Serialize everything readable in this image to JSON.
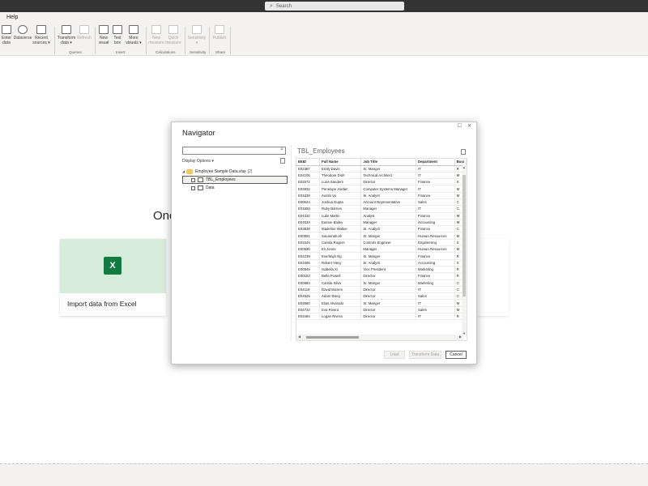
{
  "titlebar": {
    "search_placeholder": "Search"
  },
  "menu": {
    "help": "Help"
  },
  "ribbon": {
    "buttons": [
      {
        "label1": "Enter",
        "label2": "data",
        "disabled": false
      },
      {
        "label1": "Dataverse",
        "label2": "",
        "disabled": false
      },
      {
        "label1": "Recent",
        "label2": "sources ▾",
        "disabled": false
      },
      {
        "label1": "Transform",
        "label2": "data ▾",
        "disabled": false
      },
      {
        "label1": "Refresh",
        "label2": "",
        "disabled": true
      },
      {
        "label1": "New",
        "label2": "visual",
        "disabled": false
      },
      {
        "label1": "Text",
        "label2": "box",
        "disabled": false
      },
      {
        "label1": "More",
        "label2": "visuals ▾",
        "disabled": false
      },
      {
        "label1": "New",
        "label2": "measure",
        "disabled": true
      },
      {
        "label1": "Quick",
        "label2": "measure",
        "disabled": true
      },
      {
        "label1": "Sensitivity",
        "label2": "▾",
        "disabled": true
      },
      {
        "label1": "Publish",
        "label2": "",
        "disabled": true
      }
    ],
    "groups": [
      "Queries",
      "Insert",
      "Calculations",
      "Sensitivity",
      "Share"
    ]
  },
  "canvas": {
    "heading_partial": "Onc",
    "card_label": "Import data from Excel",
    "card_icon": "excel-icon"
  },
  "navigator": {
    "title": "Navigator",
    "display_options": "Display Options ▾",
    "tree": {
      "root_label": "Employee Sample Data.xlsx",
      "root_count": "[2]",
      "items": [
        "TBL_Employees",
        "Data"
      ]
    },
    "preview_title": "TBL_Employees",
    "columns": [
      "EEID",
      "Full Name",
      "Job Title",
      "Department",
      "Busi"
    ],
    "rows": [
      [
        "E02387",
        "Emily Davis",
        "Sr. Manger",
        "IT",
        "R"
      ],
      [
        "E04105",
        "Theodore Dinh",
        "Technical Architect",
        "IT",
        "M"
      ],
      [
        "E02572",
        "Luna Sanders",
        "Director",
        "Finance",
        "S"
      ],
      [
        "E02832",
        "Penelope Jordan",
        "Computer Systems Manager",
        "IT",
        "M"
      ],
      [
        "E01639",
        "Austin Vo",
        "Sr. Analyst",
        "Finance",
        "M"
      ],
      [
        "E00644",
        "Joshua Gupta",
        "Account Representative",
        "Sales",
        "C"
      ],
      [
        "E01550",
        "Ruby Barnes",
        "Manager",
        "IT",
        "C"
      ],
      [
        "E04332",
        "Luke Martin",
        "Analyst",
        "Finance",
        "M"
      ],
      [
        "E04533",
        "Easton Bailey",
        "Manager",
        "Accounting",
        "M"
      ],
      [
        "E03838",
        "Madeline Walker",
        "Sr. Analyst",
        "Finance",
        "C"
      ],
      [
        "E00591",
        "Savannah Ali",
        "Sr. Manger",
        "Human Resources",
        "M"
      ],
      [
        "E03344",
        "Camila Rogers",
        "Controls Engineer",
        "Engineering",
        "S"
      ],
      [
        "E00530",
        "Eli Jones",
        "Manager",
        "Human Resources",
        "M"
      ],
      [
        "E04239",
        "Everleigh Ng",
        "Sr. Manger",
        "Finance",
        "R"
      ],
      [
        "E03496",
        "Robert Yang",
        "Sr. Analyst",
        "Accounting",
        "S"
      ],
      [
        "E00549",
        "Isabella Xi",
        "Vice President",
        "Marketing",
        "R"
      ],
      [
        "E00163",
        "Bella Powell",
        "Director",
        "Finance",
        "R"
      ],
      [
        "E00884",
        "Camila Silva",
        "Sr. Manger",
        "Marketing",
        "C"
      ],
      [
        "E04116",
        "David Barnes",
        "Director",
        "IT",
        "C"
      ],
      [
        "E04625",
        "Adam Dang",
        "Director",
        "Sales",
        "C"
      ],
      [
        "E03680",
        "Elias Alvarado",
        "Sr. Manger",
        "IT",
        "M"
      ],
      [
        "E04732",
        "Eva Rivera",
        "Director",
        "Sales",
        "M"
      ],
      [
        "E03484",
        "Logan Rivera",
        "Director",
        "IT",
        "R"
      ]
    ],
    "buttons": {
      "load": "Load",
      "transform": "Transform Data",
      "cancel": "Cancel"
    }
  }
}
